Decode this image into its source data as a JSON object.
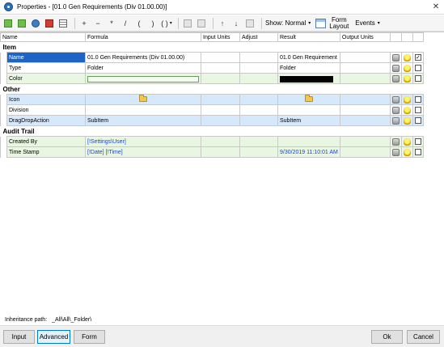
{
  "window": {
    "title": "Properties - [01.0  Gen Requirements (Div 01.00.00)]",
    "close_glyph": "✕"
  },
  "toolbar": {
    "show_label": "Show: Normal",
    "form_layout_line1": "Form",
    "form_layout_line2": "Layout",
    "events_label": "Events",
    "plus": "+",
    "minus": "−",
    "times": "*",
    "divide": "/",
    "lparen": "(",
    "rparen": ")",
    "parens": "( )",
    "up": "↑",
    "down": "↓"
  },
  "columns": {
    "name": "Name",
    "formula": "Formula",
    "input_units": "Input Units",
    "adjust": "Adjust",
    "result": "Result",
    "output_units": "Output Units"
  },
  "groups": [
    {
      "label": "Item",
      "rows": [
        {
          "name": "Name",
          "formula": "01.0  Gen Requirements (Div 01.00.00)",
          "result": "01.0  Gen Requirement",
          "checked": true
        },
        {
          "name": "Type",
          "formula": "Folder",
          "result": "Folder",
          "checked": false
        },
        {
          "name": "Color",
          "formula": "",
          "result": "",
          "checked": false
        }
      ]
    },
    {
      "label": "Other",
      "rows": [
        {
          "name": "Icon",
          "formula": "",
          "result": "",
          "checked": false
        },
        {
          "name": "Division",
          "formula": "",
          "result": "",
          "checked": false
        },
        {
          "name": "DragDropAction",
          "formula": "SubItem",
          "result": "SubItem",
          "checked": false
        }
      ]
    },
    {
      "label": "Audit Trail",
      "rows": [
        {
          "name": "Created By",
          "formula": "[!Settings\\User]",
          "result": "",
          "checked": false
        },
        {
          "name": "Time Stamp",
          "formula": "[!Date] [!Time]",
          "result": "9/30/2019 11:10:01 AM",
          "checked": false
        }
      ]
    }
  ],
  "inheritance": {
    "label": "Inheritance path:",
    "path": "_All\\All\\_Folder\\"
  },
  "footer": {
    "input": "Input",
    "advanced": "Advanced",
    "form": "Form",
    "ok": "Ok",
    "cancel": "Cancel"
  }
}
